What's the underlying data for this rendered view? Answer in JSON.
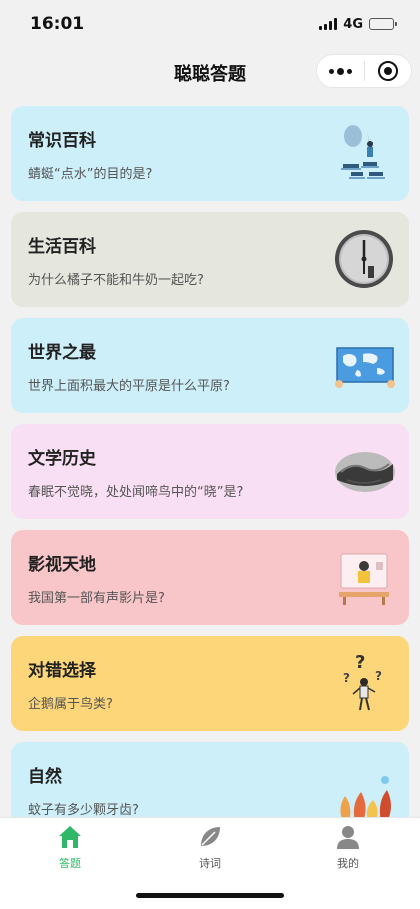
{
  "status": {
    "time": "16:01",
    "network": "4G"
  },
  "nav": {
    "title": "聪聪答题"
  },
  "cards": [
    {
      "title": "常识百科",
      "question": "蜻蜓“点水”的目的是?",
      "bg": "#cdeff9",
      "icon": "person-on-stones-illustration"
    },
    {
      "title": "生活百科",
      "question": "为什么橘子不能和牛奶一起吃?",
      "bg": "#e5e6de",
      "icon": "clock-illustration"
    },
    {
      "title": "世界之最",
      "question": "世界上面积最大的平原是什么平原?",
      "bg": "#cdeff9",
      "icon": "world-map-illustration"
    },
    {
      "title": "文学历史",
      "question": "春眠不觉晓，处处闻啼鸟中的“晓”是?",
      "bg": "#f8dff3",
      "icon": "great-wall-illustration"
    },
    {
      "title": "影视天地",
      "question": "我国第一部有声影片是?",
      "bg": "#f8c6c8",
      "icon": "video-call-illustration"
    },
    {
      "title": "对错选择",
      "question": "企鹅属于鸟类?",
      "bg": "#fdd679",
      "icon": "question-marks-illustration"
    },
    {
      "title": "自然",
      "question": "蚊子有多少颗牙齿?",
      "bg": "#cdeff9",
      "icon": "autumn-trees-illustration"
    }
  ],
  "tabs": [
    {
      "label": "答题",
      "active": true
    },
    {
      "label": "诗词",
      "active": false
    },
    {
      "label": "我的",
      "active": false
    }
  ],
  "colors": {
    "accent": "#2fb86a",
    "inactive_icon": "#888888"
  }
}
